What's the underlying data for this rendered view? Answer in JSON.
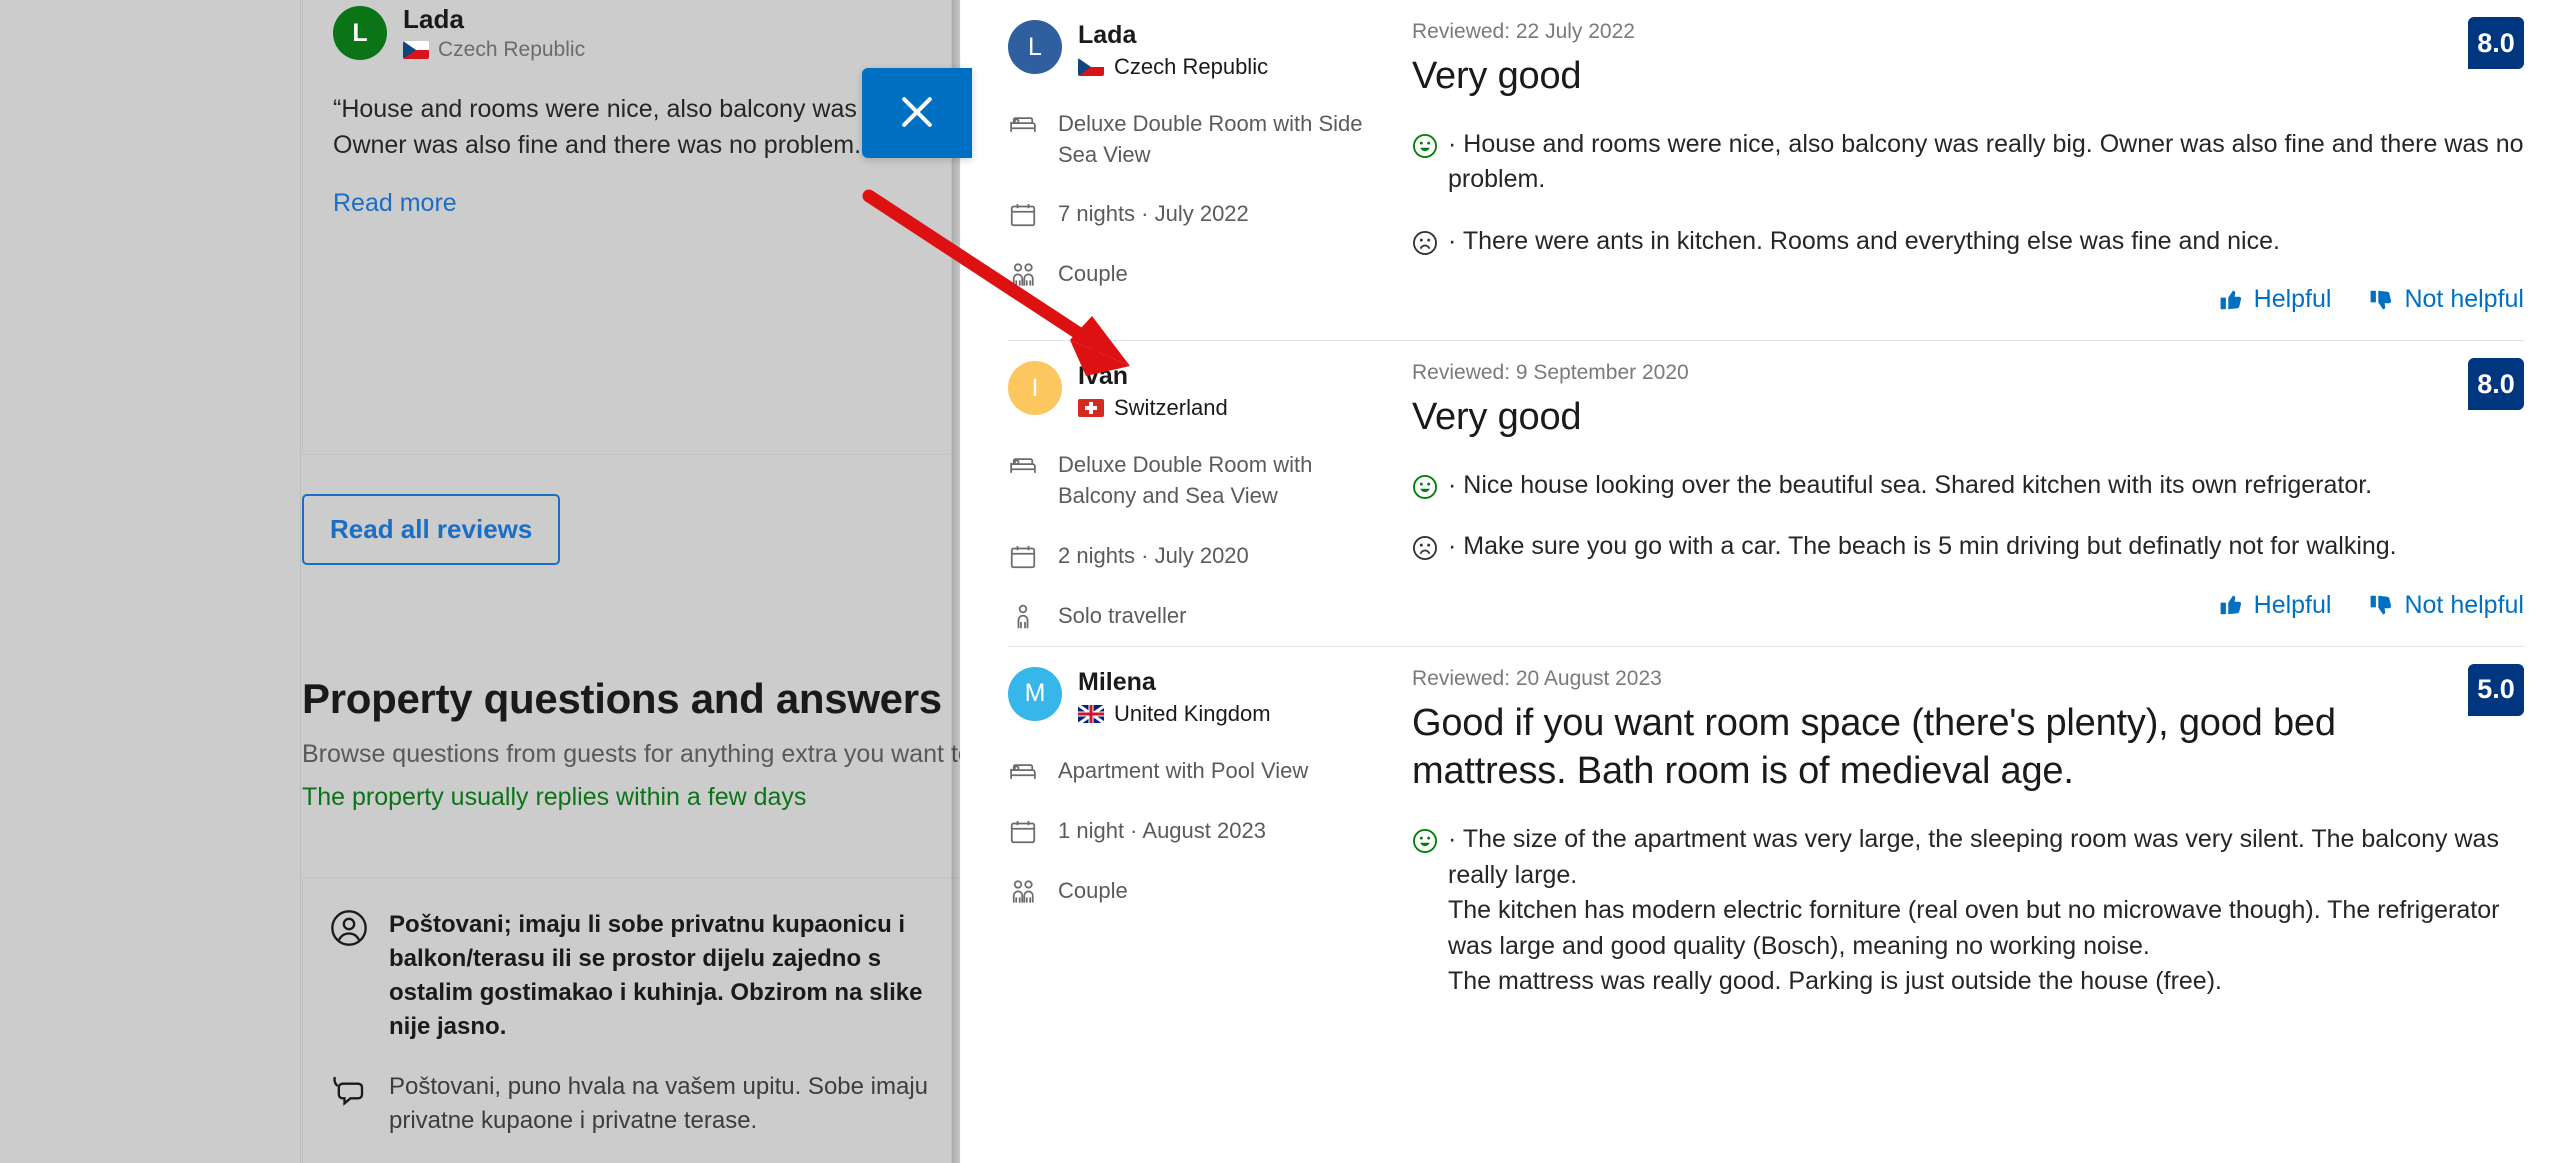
{
  "background": {
    "review_card": {
      "avatar_initial": "L",
      "avatar_color": "#0a7417",
      "name": "Lada",
      "country": "Czech Republic",
      "flag": "czech-republic-flag",
      "quote": "“House and rooms were nice, also balcony was really big. Owner was also fine and there was no problem.”",
      "read_more_label": "Read more"
    },
    "read_all_reviews_label": "Read all reviews",
    "qa": {
      "title": "Property questions and answers",
      "subtitle": "Browse questions from guests for anything extra you want to know",
      "reply_note": "The property usually replies within a few days",
      "question": "Poštovani; imaju li sobe privatnu kupaonicu i balkon/terasu ili se prostor dijelu zajedno s ostalim gostimakao i kuhinja. Obzirom na slike nije jasno.",
      "answer": "Poštovani, puno hvala na vašem upitu. Sobe imaju privatne kupaone i privatne terase."
    }
  },
  "close_button": {
    "label": "close-modal",
    "icon": "close-icon",
    "color": "#0071c2"
  },
  "annotation": {
    "type": "red-arrow",
    "color": "#dd1111"
  },
  "modal": {
    "helpful_label": "Helpful",
    "not_helpful_label": "Not helpful",
    "reviews": [
      {
        "avatar_initial": "L",
        "avatar_color": "#2f5f9e",
        "name": "Lada",
        "country": "Czech Republic",
        "flag": "czech-republic-flag",
        "room": "Deluxe Double Room with Side Sea View",
        "stay": "7 nights ·  July 2022",
        "party": "Couple",
        "party_icon": "couple-icon",
        "date": "Reviewed: 22 July 2022",
        "title": "Very good",
        "score": "8.0",
        "positive": "House and rooms were nice, also balcony was really big. Owner was also fine and there was no problem.",
        "negative": "There were ants in kitchen. Rooms and everything else was fine and nice."
      },
      {
        "avatar_initial": "I",
        "avatar_color": "#fbc75e",
        "name": "Ivan",
        "country": "Switzerland",
        "flag": "switzerland-flag",
        "room": "Deluxe Double Room with Balcony and Sea View",
        "stay": "2 nights ·  July 2020",
        "party": "Solo traveller",
        "party_icon": "person-icon",
        "date": "Reviewed: 9 September 2020",
        "title": "Very good",
        "score": "8.0",
        "positive": "Nice house looking over the beautiful sea. Shared kitchen with its own refrigerator.",
        "negative": "Make sure you go with a car. The beach is 5 min driving but definatly not for walking."
      },
      {
        "avatar_initial": "M",
        "avatar_color": "#37b6e9",
        "name": "Milena",
        "country": "United Kingdom",
        "flag": "united-kingdom-flag",
        "room": "Apartment with Pool View",
        "stay": "1 night ·  August 2023",
        "party": "Couple",
        "party_icon": "couple-icon",
        "date": "Reviewed: 20 August 2023",
        "title": "Good if you want room space (there's plenty), good bed mattress. Bath room is of medieval age.",
        "score": "5.0",
        "positive": "The size of the apartment was very large, the sleeping room was very silent. The balcony was really large.\nThe kitchen has modern electric forniture (real oven but no microwave though). The refrigerator was large and good quality (Bosch), meaning no working noise.\nThe mattress was really good. Parking is just outside the house (free).",
        "negative": ""
      }
    ]
  }
}
